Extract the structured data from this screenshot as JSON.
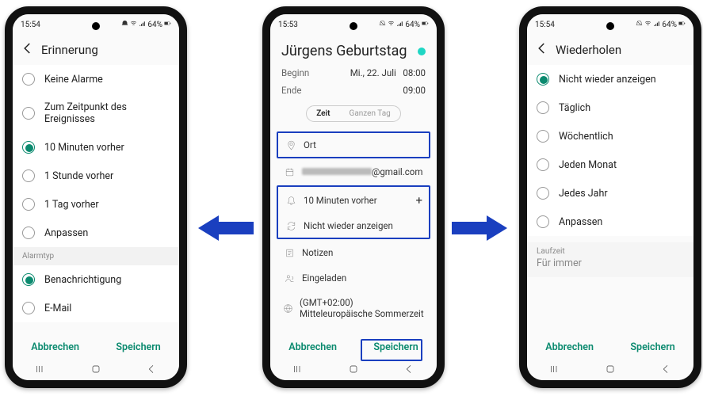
{
  "status": {
    "time1": "15:54",
    "time2": "15:53",
    "time3": "15:54",
    "battery": "64%"
  },
  "left": {
    "title": "Erinnerung",
    "options": [
      "Keine Alarme",
      "Zum Zeitpunkt des Ereignisses",
      "10 Minuten vorher",
      "1 Stunde vorher",
      "1 Tag vorher",
      "Anpassen"
    ],
    "selected_index": 2,
    "type_label": "Alarmtyp",
    "types": [
      "Benachrichtigung",
      "E-Mail"
    ],
    "type_selected": 0,
    "cancel": "Abbrechen",
    "save": "Speichern"
  },
  "center": {
    "event_title": "Jürgens Geburtstag",
    "start_label": "Beginn",
    "start_date": "Mi., 22. Juli",
    "start_time": "08:00",
    "end_label": "Ende",
    "end_time": "09:00",
    "seg_time": "Zeit",
    "seg_allday": "Ganzen Tag",
    "location_label": "Ort",
    "account_suffix": "@gmail.com",
    "reminder_text": "10 Minuten vorher",
    "repeat_text": "Nicht wieder anzeigen",
    "notes_label": "Notizen",
    "invited_label": "Eingeladen",
    "timezone": "(GMT+02:00) Mitteleuropäische Sommerzeit",
    "cancel": "Abbrechen",
    "save": "Speichern"
  },
  "right": {
    "title": "Wiederholen",
    "options": [
      "Nicht wieder anzeigen",
      "Täglich",
      "Wöchentlich",
      "Jeden Monat",
      "Jedes Jahr",
      "Anpassen"
    ],
    "selected_index": 0,
    "duration_label": "Laufzeit",
    "duration_value": "Für immer",
    "cancel": "Abbrechen",
    "save": "Speichern"
  }
}
